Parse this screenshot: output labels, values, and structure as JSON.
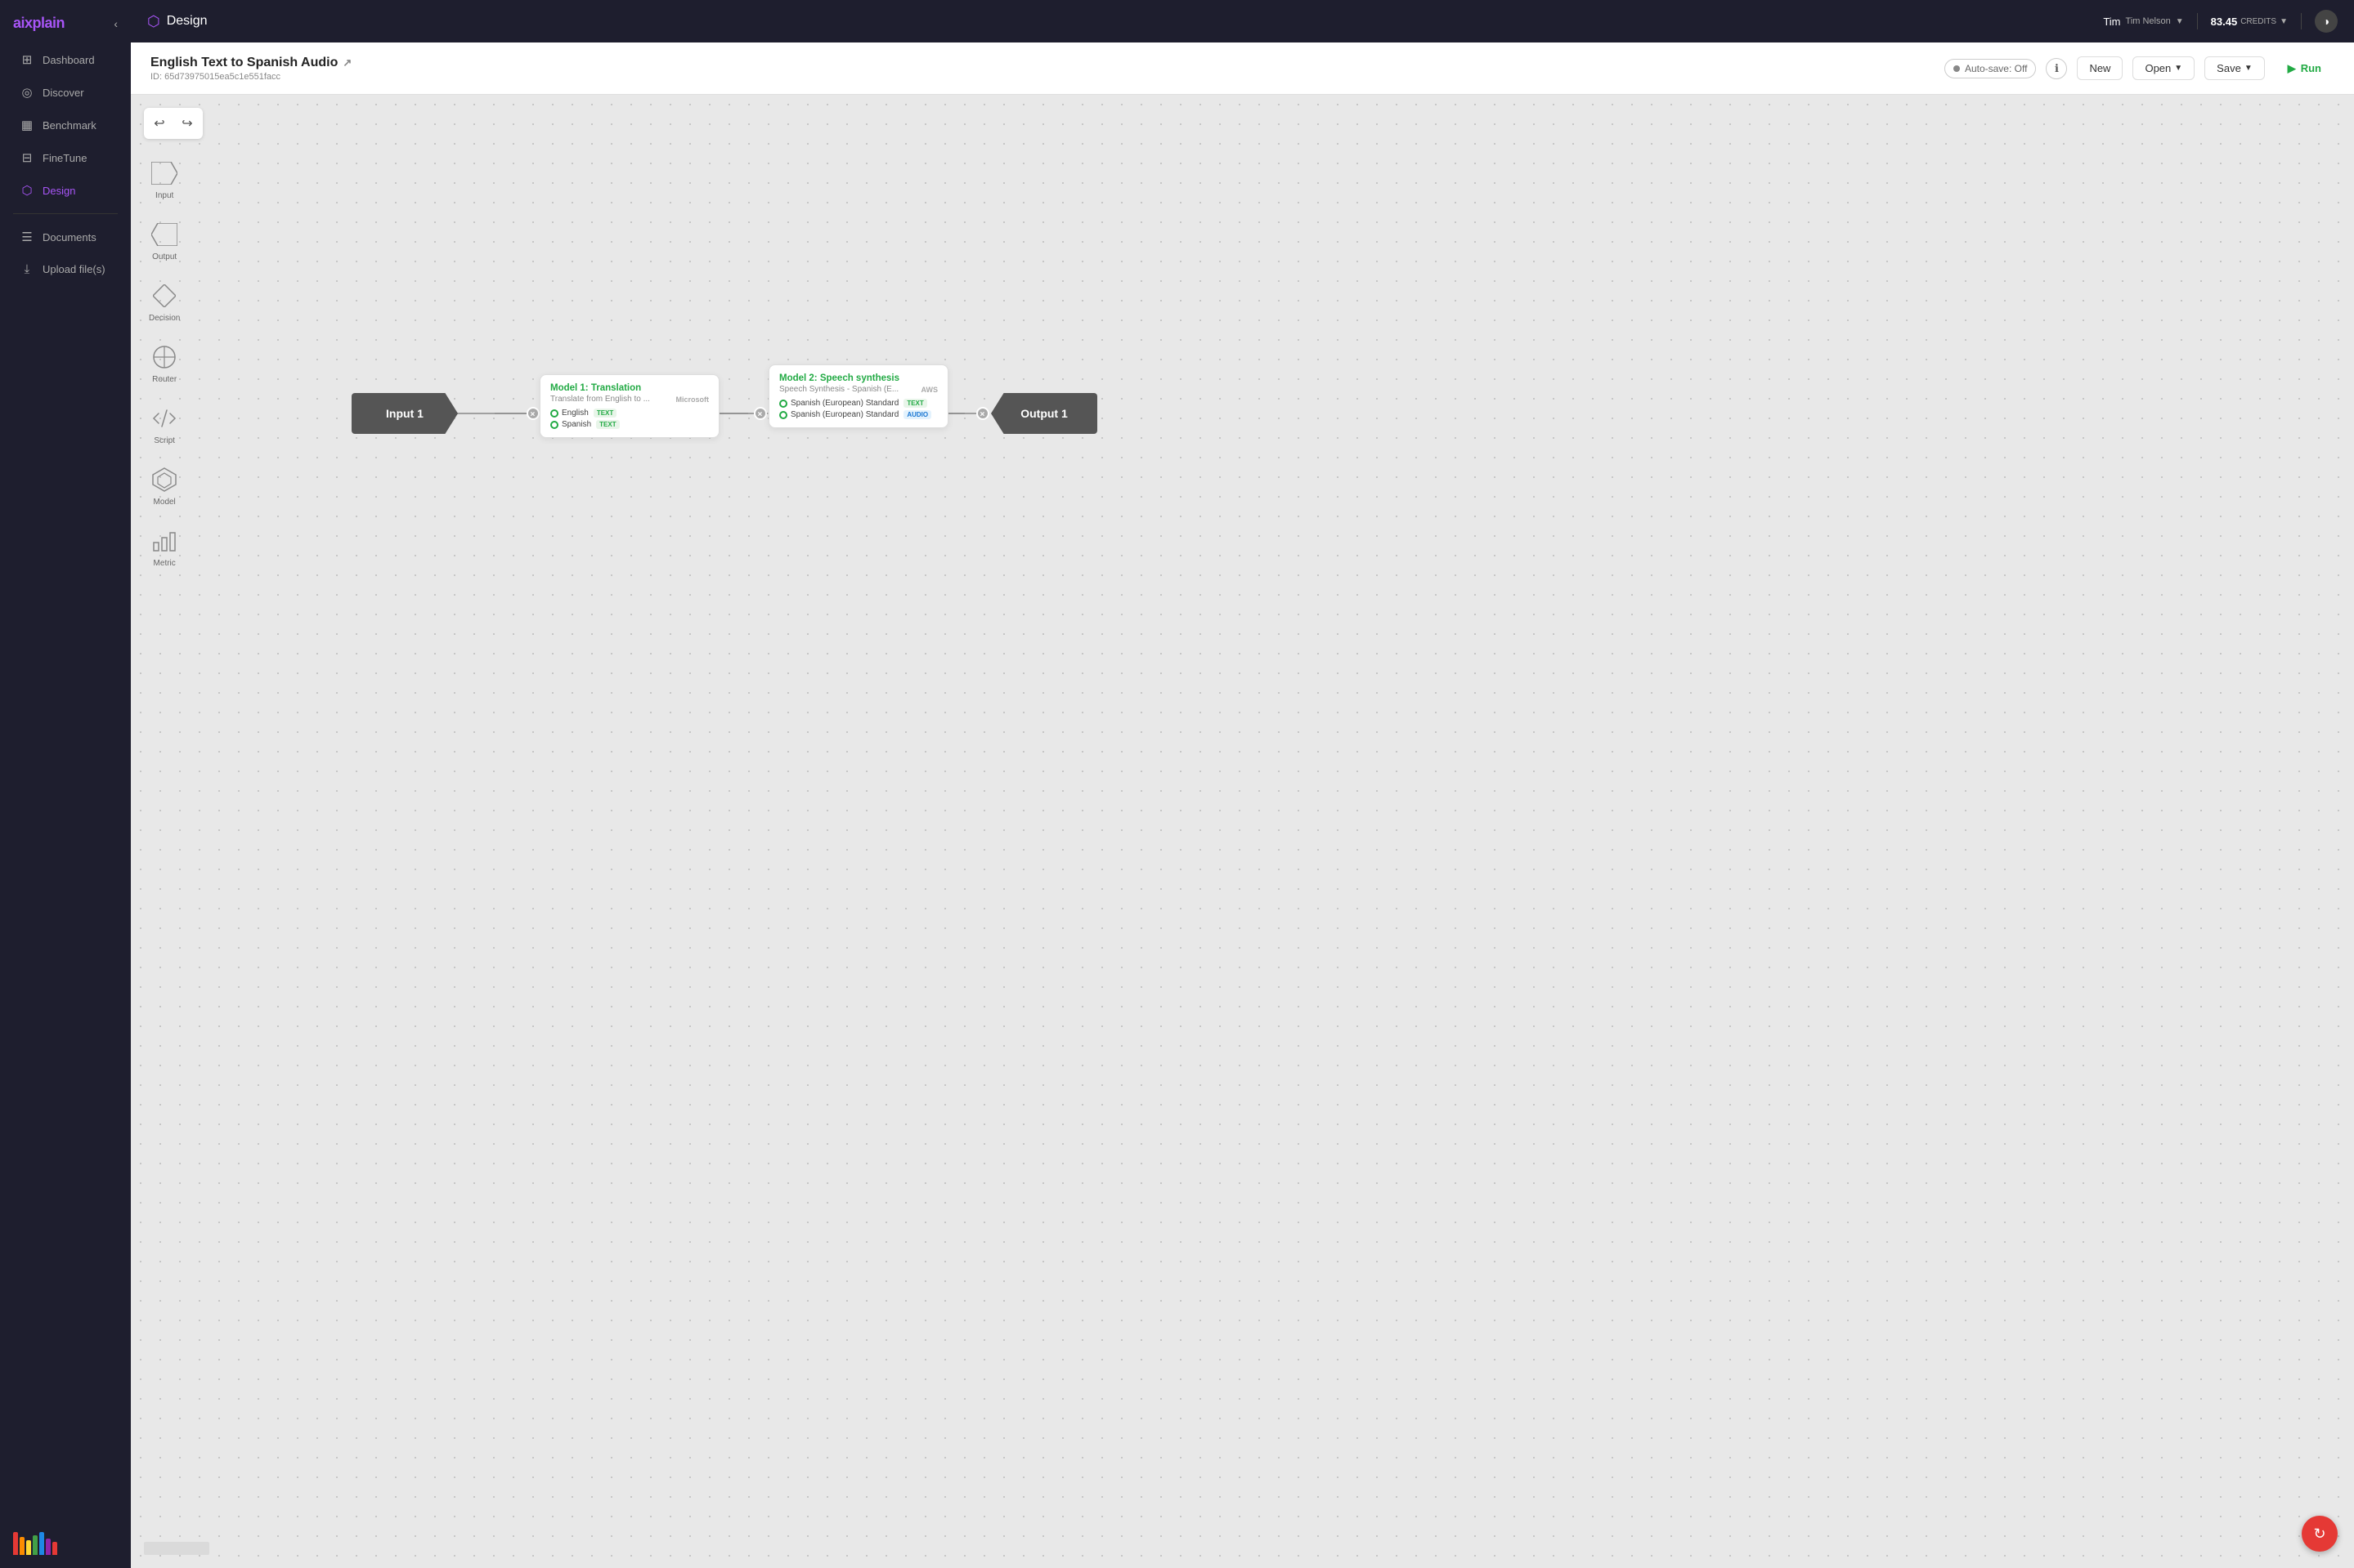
{
  "app": {
    "name": "aix",
    "name_highlight": "plain",
    "page_title": "Design",
    "page_icon": "⬡"
  },
  "topbar": {
    "user_name": "Tim",
    "user_full_name": "Tim Nelson",
    "credits_value": "83.45",
    "credits_label": "CREDITS",
    "theme_icon": "◑"
  },
  "sidebar": {
    "items": [
      {
        "id": "dashboard",
        "label": "Dashboard",
        "icon": "⊞",
        "active": false
      },
      {
        "id": "discover",
        "label": "Discover",
        "icon": "◎",
        "active": false
      },
      {
        "id": "benchmark",
        "label": "Benchmark",
        "icon": "▦",
        "active": false
      },
      {
        "id": "finetune",
        "label": "FineTune",
        "icon": "⊟",
        "active": false
      },
      {
        "id": "design",
        "label": "Design",
        "icon": "⬡",
        "active": true
      }
    ],
    "bottom_items": [
      {
        "id": "documents",
        "label": "Documents",
        "icon": "☰"
      },
      {
        "id": "upload",
        "label": "Upload file(s)",
        "icon": "⤓"
      }
    ],
    "color_bars": [
      "#e53935",
      "#fb8c00",
      "#fdd835",
      "#43a047",
      "#1e88e5",
      "#8e24aa",
      "#e53935"
    ]
  },
  "pipeline": {
    "title": "English Text to Spanish Audio",
    "ext_link": "↗",
    "id": "ID: 65d73975015ea5c1e551facc",
    "autosave": "Auto-save: Off",
    "toolbar": {
      "new_label": "New",
      "open_label": "Open",
      "save_label": "Save",
      "run_label": "Run"
    }
  },
  "canvas_tools": {
    "undo": "↩",
    "redo": "↪"
  },
  "tools": [
    {
      "id": "input",
      "label": "Input"
    },
    {
      "id": "output",
      "label": "Output"
    },
    {
      "id": "decision",
      "label": "Decision"
    },
    {
      "id": "router",
      "label": "Router"
    },
    {
      "id": "script",
      "label": "Script"
    },
    {
      "id": "model",
      "label": "Model"
    },
    {
      "id": "metric",
      "label": "Metric"
    }
  ],
  "nodes": {
    "input1": {
      "label": "Input 1"
    },
    "model1": {
      "title": "Model 1: Translation",
      "subtitle": "Translate from English to ...",
      "badge": "Microsoft",
      "ios": [
        {
          "name": "English",
          "type": "TEXT"
        },
        {
          "name": "Spanish",
          "type": "TEXT"
        }
      ]
    },
    "model2": {
      "title": "Model 2: Speech synthesis",
      "subtitle": "Speech Synthesis - Spanish (E...",
      "badge": "AWS",
      "ios": [
        {
          "name": "Spanish (European) Standard",
          "type": "TEXT"
        },
        {
          "name": "Spanish (European) Standard",
          "type": "AUDIO"
        }
      ]
    },
    "output1": {
      "label": "Output 1"
    }
  },
  "fab": {
    "icon": "↻"
  }
}
